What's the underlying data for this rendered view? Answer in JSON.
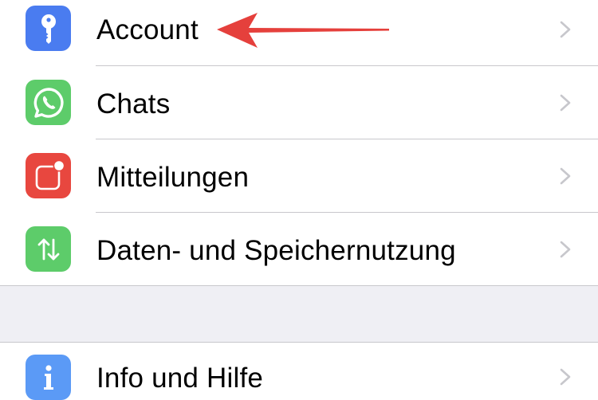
{
  "settings": {
    "group1": [
      {
        "label": "Account",
        "icon": "key-icon",
        "color": "#4a7cf0"
      },
      {
        "label": "Chats",
        "icon": "whatsapp-icon",
        "color": "#5dcc6a"
      },
      {
        "label": "Mitteilungen",
        "icon": "notification-icon",
        "color": "#e8473f"
      },
      {
        "label": "Daten- und Speichernutzung",
        "icon": "data-transfer-icon",
        "color": "#5dcc6a"
      }
    ],
    "group2": [
      {
        "label": "Info und Hilfe",
        "icon": "info-icon",
        "color": "#5b9af6"
      }
    ]
  },
  "annotation": {
    "type": "arrow",
    "color": "#e5403c",
    "points_to": "Account"
  },
  "colors": {
    "background": "#ffffff",
    "group_separator": "#efeff4",
    "divider": "#c8c7cc",
    "chevron": "#c7c7cc"
  }
}
